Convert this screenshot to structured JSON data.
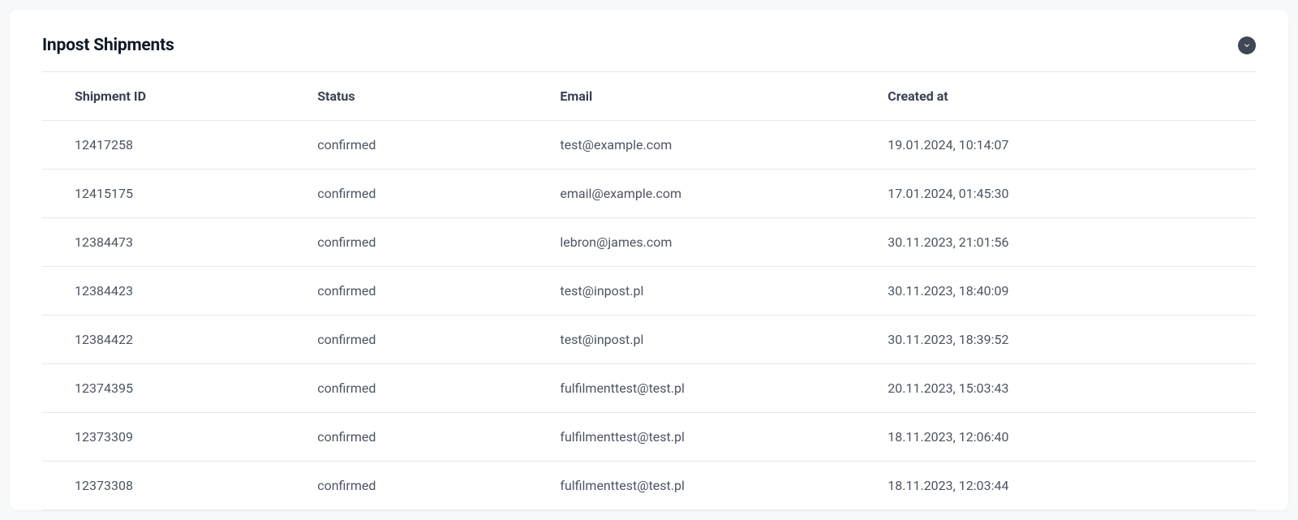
{
  "card": {
    "title": "Inpost Shipments"
  },
  "table": {
    "headers": {
      "shipment_id": "Shipment ID",
      "status": "Status",
      "email": "Email",
      "created_at": "Created at"
    },
    "rows": [
      {
        "shipment_id": "12417258",
        "status": "confirmed",
        "email": "test@example.com",
        "created_at": "19.01.2024, 10:14:07"
      },
      {
        "shipment_id": "12415175",
        "status": "confirmed",
        "email": "email@example.com",
        "created_at": "17.01.2024, 01:45:30"
      },
      {
        "shipment_id": "12384473",
        "status": "confirmed",
        "email": "lebron@james.com",
        "created_at": "30.11.2023, 21:01:56"
      },
      {
        "shipment_id": "12384423",
        "status": "confirmed",
        "email": "test@inpost.pl",
        "created_at": "30.11.2023, 18:40:09"
      },
      {
        "shipment_id": "12384422",
        "status": "confirmed",
        "email": "test@inpost.pl",
        "created_at": "30.11.2023, 18:39:52"
      },
      {
        "shipment_id": "12374395",
        "status": "confirmed",
        "email": "fulfilmenttest@test.pl",
        "created_at": "20.11.2023, 15:03:43"
      },
      {
        "shipment_id": "12373309",
        "status": "confirmed",
        "email": "fulfilmenttest@test.pl",
        "created_at": "18.11.2023, 12:06:40"
      },
      {
        "shipment_id": "12373308",
        "status": "confirmed",
        "email": "fulfilmenttest@test.pl",
        "created_at": "18.11.2023, 12:03:44"
      }
    ]
  }
}
